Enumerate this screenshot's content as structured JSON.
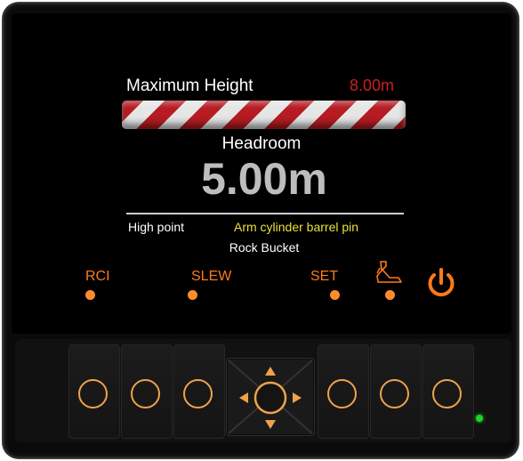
{
  "display": {
    "max_height_label": "Maximum Height",
    "max_height_value": "8.00m",
    "headroom_label": "Headroom",
    "headroom_value": "5.00m",
    "high_point_label": "High point",
    "high_point_value": "Arm cylinder barrel pin",
    "tool_name": "Rock Bucket"
  },
  "indicators": {
    "rci": "RCI",
    "slew": "SLEW",
    "set": "SET",
    "bucket_icon": "bucket-icon",
    "power_icon": "power-icon"
  },
  "keypad": {
    "nav_icons": [
      "arrow-up-icon",
      "arrow-down-icon",
      "arrow-left-icon",
      "arrow-right-icon"
    ],
    "status_led": "green"
  },
  "colors": {
    "accent": "#ff8c2a",
    "max_value": "#cc1f1f",
    "high_point_value": "#e6e03a",
    "stripe_red": "#b61c22",
    "led": "#1ed12e"
  }
}
